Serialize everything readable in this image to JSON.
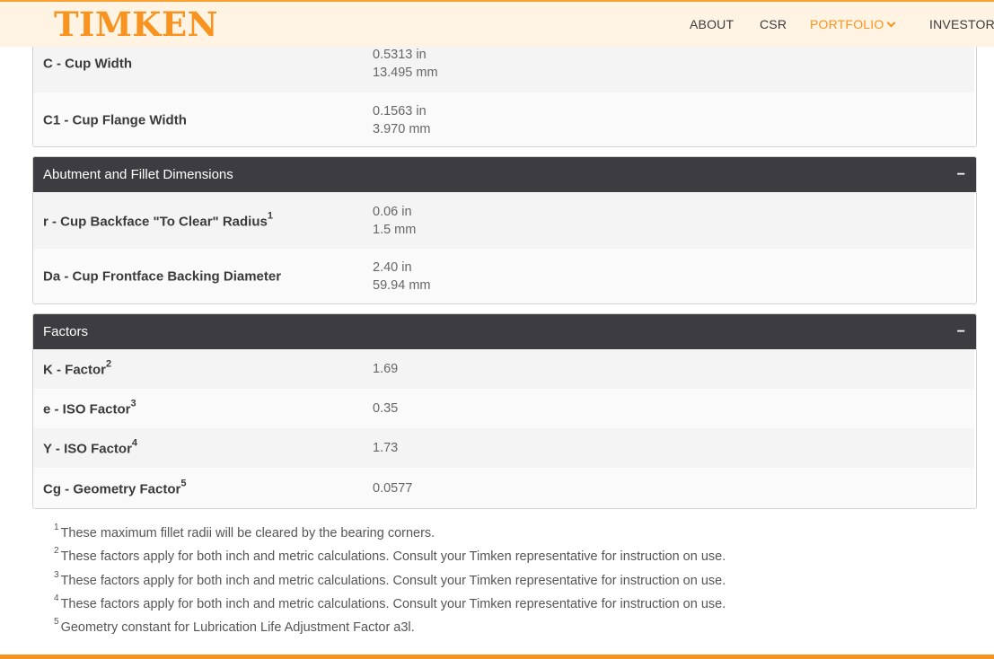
{
  "header": {
    "logo": "TIMKEN",
    "nav": {
      "about": "ABOUT",
      "csr": "CSR",
      "portfolio": "PORTFOLIO",
      "investors": "INVESTORS"
    }
  },
  "cup_dimensions": {
    "rows": [
      {
        "label": "C - Cup Width",
        "value_in": "0.5313 in",
        "value_mm": "13.495 mm"
      },
      {
        "label": "C1 - Cup Flange Width",
        "value_in": "0.1563 in",
        "value_mm": "3.970 mm"
      }
    ]
  },
  "abutment": {
    "title": "Abutment and Fillet Dimensions",
    "collapse": "−",
    "rows": [
      {
        "label": "r - Cup Backface \"To Clear\" Radius",
        "sup": "1",
        "value_in": "0.06 in",
        "value_mm": "1.5 mm"
      },
      {
        "label": "Da - Cup Frontface Backing Diameter",
        "value_in": "2.40 in",
        "value_mm": "59.94 mm"
      }
    ]
  },
  "factors": {
    "title": "Factors",
    "collapse": "−",
    "rows": [
      {
        "label": "K - Factor",
        "sup": "2",
        "value": "1.69"
      },
      {
        "label": "e - ISO Factor",
        "sup": "3",
        "value": "0.35"
      },
      {
        "label": "Y - ISO Factor",
        "sup": "4",
        "value": "1.73"
      },
      {
        "label": "Cg - Geometry Factor",
        "sup": "5",
        "value": "0.0577"
      }
    ]
  },
  "footnotes": [
    {
      "num": "1",
      "text": "These maximum fillet radii will be cleared by the bearing corners."
    },
    {
      "num": "2",
      "text": "These factors apply for both inch and metric calculations. Consult your Timken representative for instruction on use."
    },
    {
      "num": "3",
      "text": "These factors apply for both inch and metric calculations. Consult your Timken representative for instruction on use."
    },
    {
      "num": "4",
      "text": "These factors apply for both inch and metric calculations. Consult your Timken representative for instruction on use."
    },
    {
      "num": "5",
      "text": "Geometry constant for Lubrication Life Adjustment Factor a3l."
    }
  ],
  "colors": {
    "brand_orange": "#f7931e",
    "header_bg": "#fff3e4",
    "panel_header_bg": "#3d3c40"
  }
}
